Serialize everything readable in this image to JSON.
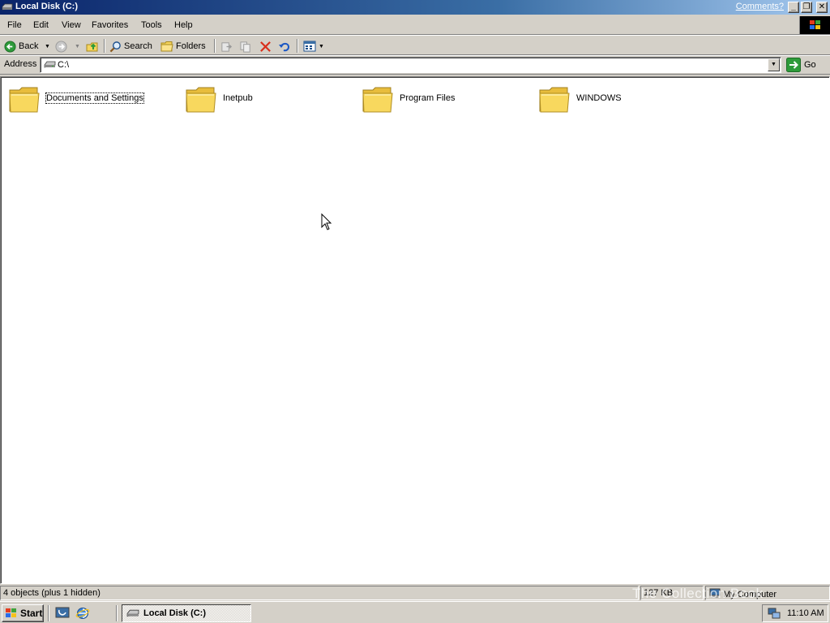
{
  "window": {
    "title": "Local Disk (C:)",
    "comments_link": "Comments?",
    "minimize_glyph": "_",
    "maximize_glyph": "❐",
    "close_glyph": "✕"
  },
  "menu": {
    "items": [
      {
        "label": "File"
      },
      {
        "label": "Edit"
      },
      {
        "label": "View"
      },
      {
        "label": "Favorites"
      },
      {
        "label": "Tools"
      },
      {
        "label": "Help"
      }
    ]
  },
  "toolbar": {
    "back_label": "Back",
    "search_label": "Search",
    "folders_label": "Folders"
  },
  "address": {
    "label": "Address",
    "value": "C:\\",
    "go_label": "Go"
  },
  "content": {
    "items": [
      {
        "name": "Documents and Settings",
        "icon": "folder-icon",
        "focused": true
      },
      {
        "name": "Inetpub",
        "icon": "folder-icon"
      },
      {
        "name": "Program Files",
        "icon": "folder-icon"
      },
      {
        "name": "WINDOWS",
        "icon": "folder-icon"
      }
    ]
  },
  "status": {
    "objects": "4 objects (plus 1 hidden)",
    "size": "127 KB",
    "zone": "My Computer"
  },
  "taskbar": {
    "start_label": "Start",
    "task_label": "Local Disk (C:)",
    "clock": "11:10 AM"
  },
  "watermark": "The Collection Book",
  "colors": {
    "title_bar": "#0a246a",
    "window_face": "#d4d0c8",
    "folder_yellow": "#f5d45e"
  }
}
